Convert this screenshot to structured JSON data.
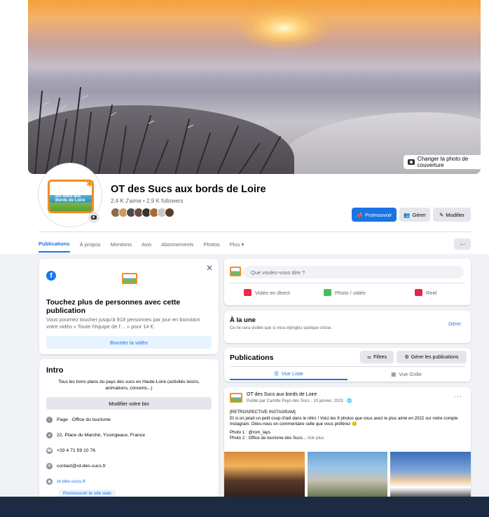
{
  "cover": {
    "change_label": "Changer la photo de couverture"
  },
  "profile": {
    "title": "OT des Sucs aux bords de Loire",
    "stats": "2,4 K J'aime • 2,9 K followers",
    "logo_text": "les Sucs aux Bords de Loire"
  },
  "actions": {
    "promote": "Promouvoir",
    "manage": "Gérer",
    "edit": "Modifier"
  },
  "tabs": [
    {
      "label": "Publications"
    },
    {
      "label": "À propos"
    },
    {
      "label": "Mentions"
    },
    {
      "label": "Avis"
    },
    {
      "label": "Abonnements"
    },
    {
      "label": "Photos"
    },
    {
      "label": "Plus ▾"
    }
  ],
  "tabs_more": "···",
  "boost": {
    "title": "Touchez plus de personnes avec cette publication",
    "description": "Vous pourriez toucher jusqu'à 918 personnes par jour en boostant votre vidéo « Toute l'équipe de l'... » pour 14 €.",
    "button": "Booster la vidéo"
  },
  "intro": {
    "title": "Intro",
    "description": "Tous les bons plans du pays des sucs en Haute-Loire (activités loisirs, animations, concerts...)",
    "edit_bio": "Modifier votre bio",
    "rows": [
      {
        "text": "Page · Office du tourisme"
      },
      {
        "text": "22, Place du Marché, Yssingeaux, France"
      },
      {
        "text": "+33 4 71 59 10 76"
      },
      {
        "text": "contact@ot-des-sucs.fr"
      },
      {
        "text": "ot-des-sucs.fr"
      }
    ],
    "promote_site": "Promouvoir le site web"
  },
  "composer": {
    "placeholder": "Que voulez-vous dire ?",
    "live": "Vidéo en direct",
    "photo": "Photo / vidéo",
    "reel": "Reel"
  },
  "alaune": {
    "title": "À la une",
    "subtitle": "Ce ne sera visible que si vous épinglez quelque chose.",
    "manage": "Gérer"
  },
  "publications": {
    "title": "Publications",
    "filters": "Filtres",
    "manage_posts": "Gérer les publications",
    "view_list": "Vue Liste",
    "view_grid": "Vue Grille"
  },
  "post": {
    "author": "OT des Sucs aux bords de Loire",
    "meta": "Publié par Camille Pays des Sucs · 10 janvier, 2023 · 🌐",
    "line1": "[RETROSPECTIVE INSTAGRAM]",
    "line2": "Et si on jetait un petit coup d'œil dans le rétro ! Voici les 9 photos que vous avez le plus aimé en 2022 sur notre compte Instagram. Dites-nous en commentaire celle que vous préférez 😊",
    "line3": "Photo 1 : @rom_lays",
    "line4": "Photo 2 : Office de tourisme des Sucs...",
    "more": "Voir plus",
    "dots": "···"
  },
  "colors": {
    "accent": "#1b74e4",
    "logo_orange": "#f28d22",
    "bottom_bar": "#1c2b41"
  }
}
